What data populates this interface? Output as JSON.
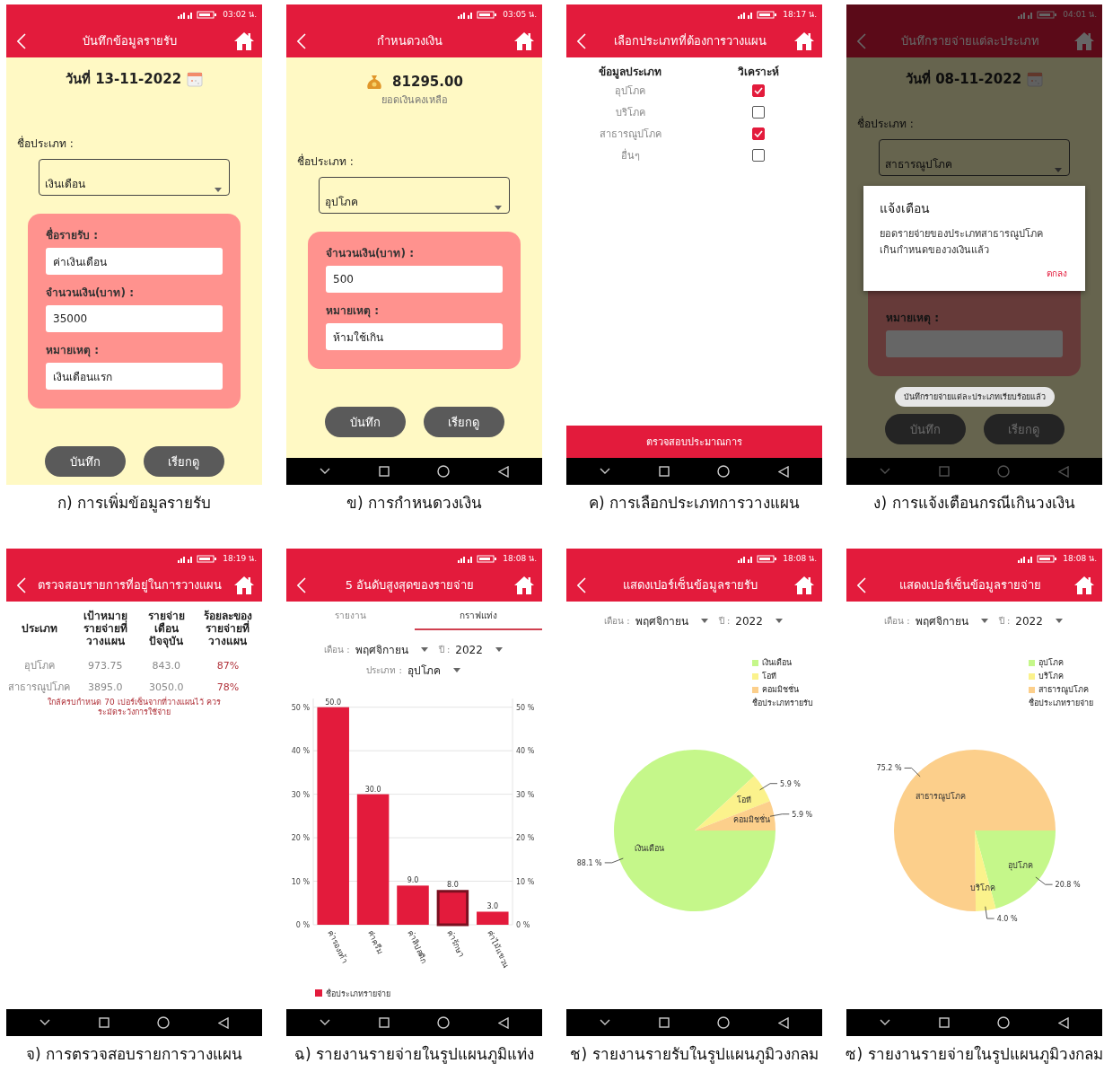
{
  "panels": [
    {
      "caption": "ก) การเพิ่มข้อมูลรายรับ",
      "screen": {
        "kind": "form",
        "status_time": "03:02 น.",
        "title": "บันทึกข้อมูลรายรับ",
        "nav_bar": false,
        "dimmed": false,
        "date": "วันที่ 13-11-2022",
        "category_label": "ชื่อประเภท :",
        "category_value": "เงินเดือน",
        "fields": [
          {
            "label": "ชื่อรายรับ :",
            "value": "ค่าเงินเดือน"
          },
          {
            "label": "จำนวนเงิน(บาท) :",
            "value": "35000"
          },
          {
            "label": "หมายเหตุ :",
            "value": "เงินเดือนแรก"
          }
        ],
        "buttons": [
          "บันทึก",
          "เรียกดู"
        ]
      }
    },
    {
      "caption": "ข) การกำหนดวงเงิน",
      "screen": {
        "kind": "form",
        "status_time": "03:05 น.",
        "title": "กำหนดวงเงิน",
        "nav_bar": true,
        "dimmed": false,
        "balance": "81295.00",
        "balance_label": "ยอดเงินคงเหลือ",
        "category_label": "ชื่อประเภท :",
        "category_value": "อุปโภค",
        "fields": [
          {
            "label": "จำนวนเงิน(บาท) :",
            "value": "500"
          },
          {
            "label": "หมายเหตุ :",
            "value": "ห้ามใช้เกิน"
          }
        ],
        "buttons": [
          "บันทึก",
          "เรียกดู"
        ]
      }
    },
    {
      "caption": "ค) การเลือกประเภทการวางแผน",
      "screen": {
        "kind": "checklist",
        "status_time": "18:17 น.",
        "title": "เลือกประเภทที่ต้องการวางแผน",
        "nav_bar": true,
        "dimmed": false,
        "columns": [
          "ข้อมูลประเภท",
          "วิเคราะห์"
        ],
        "items": [
          {
            "label": "อุปโภค",
            "checked": true
          },
          {
            "label": "บริโภค",
            "checked": false
          },
          {
            "label": "สาธารณูปโภค",
            "checked": true
          },
          {
            "label": "อื่นๆ",
            "checked": false
          }
        ],
        "action": "ตรวจสอบประมาณการ"
      }
    },
    {
      "caption": "ง) การแจ้งเตือนกรณีเกินวงเงิน",
      "screen": {
        "kind": "form",
        "status_time": "04:01 น.",
        "title": "บันทึกรายจ่ายแต่ละประเภท",
        "nav_bar": true,
        "dimmed": true,
        "date": "วันที่ 08-11-2022",
        "category_label": "ชื่อประเภท :",
        "category_value": "สาธารณูปโภค",
        "fields": [
          {
            "label": "หมายเหตุ :"
          }
        ],
        "toast": "บันทึกรายจ่ายแต่ละประเภทเรียบร้อยแล้ว",
        "buttons": [
          "บันทึก",
          "เรียกดู"
        ],
        "dialog": {
          "title": "แจ้งเตือน",
          "message": "ยอดรายจ่ายของประเภทสาธารณูปโภค เกินกำหนดของวงเงินแล้ว",
          "button": "ตกลง"
        }
      }
    },
    {
      "caption": "จ) การตรวจสอบรายการวางแผน",
      "screen": {
        "kind": "table",
        "status_time": "18:19 น.",
        "title": "ตรวจสอบรายการที่อยู่ในการวางแผน",
        "nav_bar": true,
        "dimmed": false,
        "columns": [
          "ประเภท",
          "เป้าหมาย รายจ่ายที่ วางแผน",
          "รายจ่ายเดือน ปัจจุบัน",
          "ร้อยละของ รายจ่ายที่ วางแผน"
        ],
        "rows": [
          [
            "อุปโภค",
            "973.75",
            "843.0",
            "87%"
          ],
          [
            "สาธารณูปโภค",
            "3895.0",
            "3050.0",
            "78%"
          ]
        ],
        "warning": "ใกล้ครบกำหนด 70 เปอร์เซ็นจากที่วางแผนไว้ ควรระมัดระวังการใช้จ่าย"
      }
    },
    {
      "caption": "ฉ) รายงานรายจ่ายในรูปแผนภูมิแท่ง",
      "screen": {
        "kind": "bar_report",
        "status_time": "18:08 น.",
        "title": "5 อันดับสูงสุดของรายจ่าย",
        "nav_bar": true,
        "dimmed": false,
        "tabs": [
          {
            "label": "รายงาน",
            "selected": false
          },
          {
            "label": "กราฟแท่ง",
            "selected": true
          }
        ],
        "filters": [
          {
            "label": "เดือน :",
            "value": "พฤศจิกายน"
          },
          {
            "label": "ปี :",
            "value": "2022"
          },
          {
            "label": "ประเภท :",
            "value": "อุปโภค"
          }
        ],
        "bar_selected": [
          false,
          false,
          false,
          true,
          false
        ],
        "right_axis_labels": [
          "50 %",
          "40 %",
          "30 %",
          "20 %",
          "10 %",
          "0 %"
        ],
        "chart_data": {
          "type": "bar",
          "grid": true,
          "categories": [
            "ค่ารองเท้า",
            "ค่าครีม",
            "ค่าลิปสติก",
            "ค่ารักษา",
            "ค่าไม้แขวน"
          ],
          "series": [
            {
              "name": "ชื่อประเภทรายจ่าย",
              "color": "#e31b3c",
              "values": [
                50,
                30,
                9,
                8,
                3
              ]
            }
          ],
          "ylim": [
            0,
            52
          ],
          "yticks": [
            {
              "value": 0,
              "label": "0 %"
            },
            {
              "value": 10,
              "label": "10 %"
            },
            {
              "value": 20,
              "label": "20 %"
            },
            {
              "value": 30,
              "label": "30 %"
            },
            {
              "value": 40,
              "label": "40 %"
            },
            {
              "value": 50,
              "label": "50 %"
            }
          ],
          "value_labels": [
            "50.0",
            "30.0",
            "9.0",
            "8.0",
            "3.0"
          ]
        }
      }
    },
    {
      "caption": "ช) รายงานรายรับในรูปแผนภูมิวงกลม",
      "screen": {
        "kind": "pie_report",
        "status_time": "18:08 น.",
        "title": "แสดงเปอร์เซ็นข้อมูลรายรับ",
        "nav_bar": true,
        "dimmed": false,
        "filters": [
          {
            "label": "เดือน :",
            "value": "พฤศจิกายน"
          },
          {
            "label": "ปี :",
            "value": "2022"
          }
        ],
        "legend_title": "ชื่อประเภทรายรับ",
        "chart_data": {
          "type": "pie",
          "categories": [
            "เงินเดือน",
            "โอที",
            "คอมมิชชั่น"
          ],
          "values": [
            88.1,
            5.9,
            5.9
          ],
          "colors": [
            "#c5f78a",
            "#fbf28c",
            "#fccf8b"
          ],
          "value_labels": [
            "88.1 %",
            "5.9 %",
            "5.9 %"
          ]
        }
      }
    },
    {
      "caption": "ซ) รายงานรายจ่ายในรูปแผนภูมิวงกลม",
      "screen": {
        "kind": "pie_report",
        "status_time": "18:08 น.",
        "title": "แสดงเปอร์เซ็นข้อมูลรายจ่าย",
        "nav_bar": true,
        "dimmed": false,
        "filters": [
          {
            "label": "เดือน :",
            "value": "พฤศจิกายน"
          },
          {
            "label": "ปี :",
            "value": "2022"
          }
        ],
        "legend_title": "ชื่อประเภทรายจ่าย",
        "chart_data": {
          "type": "pie",
          "categories": [
            "อุปโภค",
            "บริโภค",
            "สาธารณูปโภค"
          ],
          "values": [
            20.8,
            4.0,
            75.2
          ],
          "colors": [
            "#c5f78a",
            "#fbf28c",
            "#fccf8b"
          ],
          "value_labels": [
            "20.8 %",
            "4.0 %",
            "75.2 %"
          ]
        }
      }
    }
  ]
}
